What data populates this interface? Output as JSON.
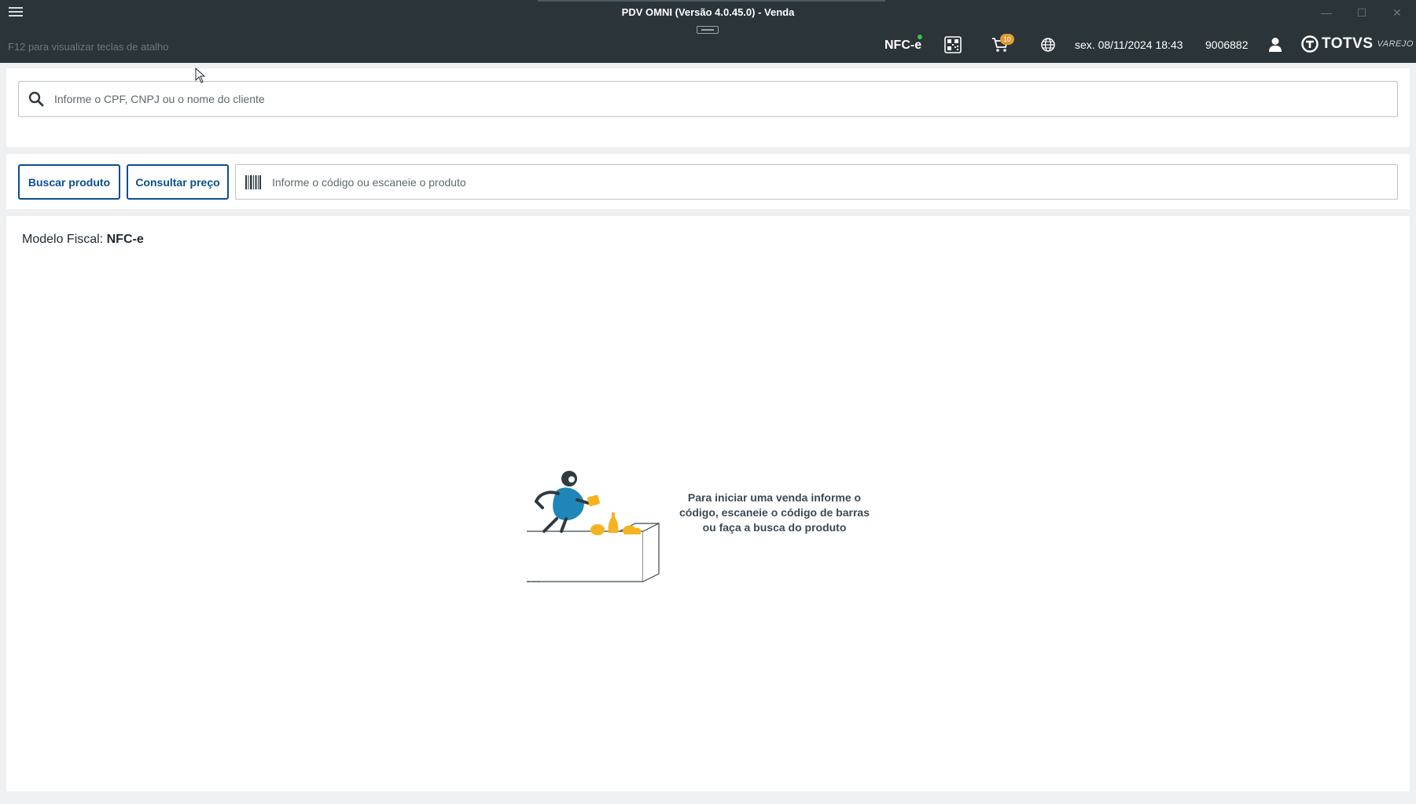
{
  "window": {
    "title": "PDV OMNI (Versão 4.0.45.0) - Venda",
    "controls": {
      "minimize": "—",
      "maximize": "☐",
      "close": "✕"
    }
  },
  "header": {
    "shortcut_hint": "F12 para visualizar teclas de atalho",
    "fiscal_badge": "NFC-e",
    "fiscal_status_color": "#3ac34e",
    "cart_count": "10",
    "datetime": "sex. 08/11/2024 18:43",
    "operator_code": "9006882",
    "logo": {
      "brand": "TOTVS",
      "sub": "VAREJO"
    },
    "icons": [
      "menu-icon",
      "qr-code-icon",
      "cart-icon",
      "globe-icon",
      "user-icon",
      "totvs-logo-icon"
    ]
  },
  "customer": {
    "search_placeholder": "Informe o CPF, CNPJ ou o nome do cliente",
    "search_value": ""
  },
  "product": {
    "buscar_label": "Buscar produto",
    "consultar_label": "Consultar preço",
    "code_placeholder": "Informe o código ou escaneie o produto",
    "code_value": ""
  },
  "main": {
    "fiscal_label": "Modelo Fiscal:",
    "fiscal_value": "NFC-e",
    "empty_message": "Para iniciar uma venda informe o código, escaneie o código de barras ou faça a busca do produto"
  },
  "colors": {
    "header_bg": "#2b3439",
    "accent_blue": "#0b4f8c",
    "badge_orange": "#e29a2c",
    "illustration_yellow": "#f5b320",
    "illustration_blue": "#1f86b7"
  }
}
